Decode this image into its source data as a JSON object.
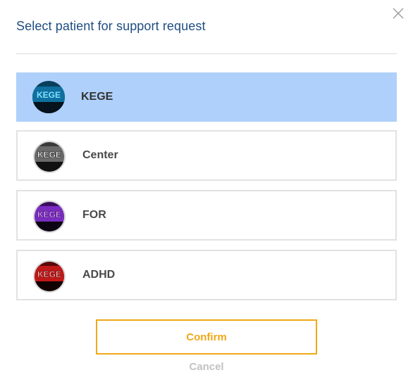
{
  "dialog": {
    "title": "Select patient for support request",
    "close_icon": "close-icon",
    "confirm_label": "Confirm",
    "cancel_label": "Cancel"
  },
  "patients": [
    {
      "name": "KEGE",
      "avatar_text": "KEGE",
      "avatar_color": "#0a6a96",
      "selected": true
    },
    {
      "name": "Center",
      "avatar_text": "KEGE",
      "avatar_color": "#2a2a2a",
      "selected": false
    },
    {
      "name": "FOR",
      "avatar_text": "KEGE",
      "avatar_color": "#5a1a8a",
      "selected": false
    },
    {
      "name": "ADHD",
      "avatar_text": "KEGE",
      "avatar_color": "#8a1010",
      "selected": false
    }
  ],
  "colors": {
    "title": "#1f4d82",
    "selected_bg": "#aed0fa",
    "accent": "#f0a818",
    "muted": "#c2c2c2"
  }
}
